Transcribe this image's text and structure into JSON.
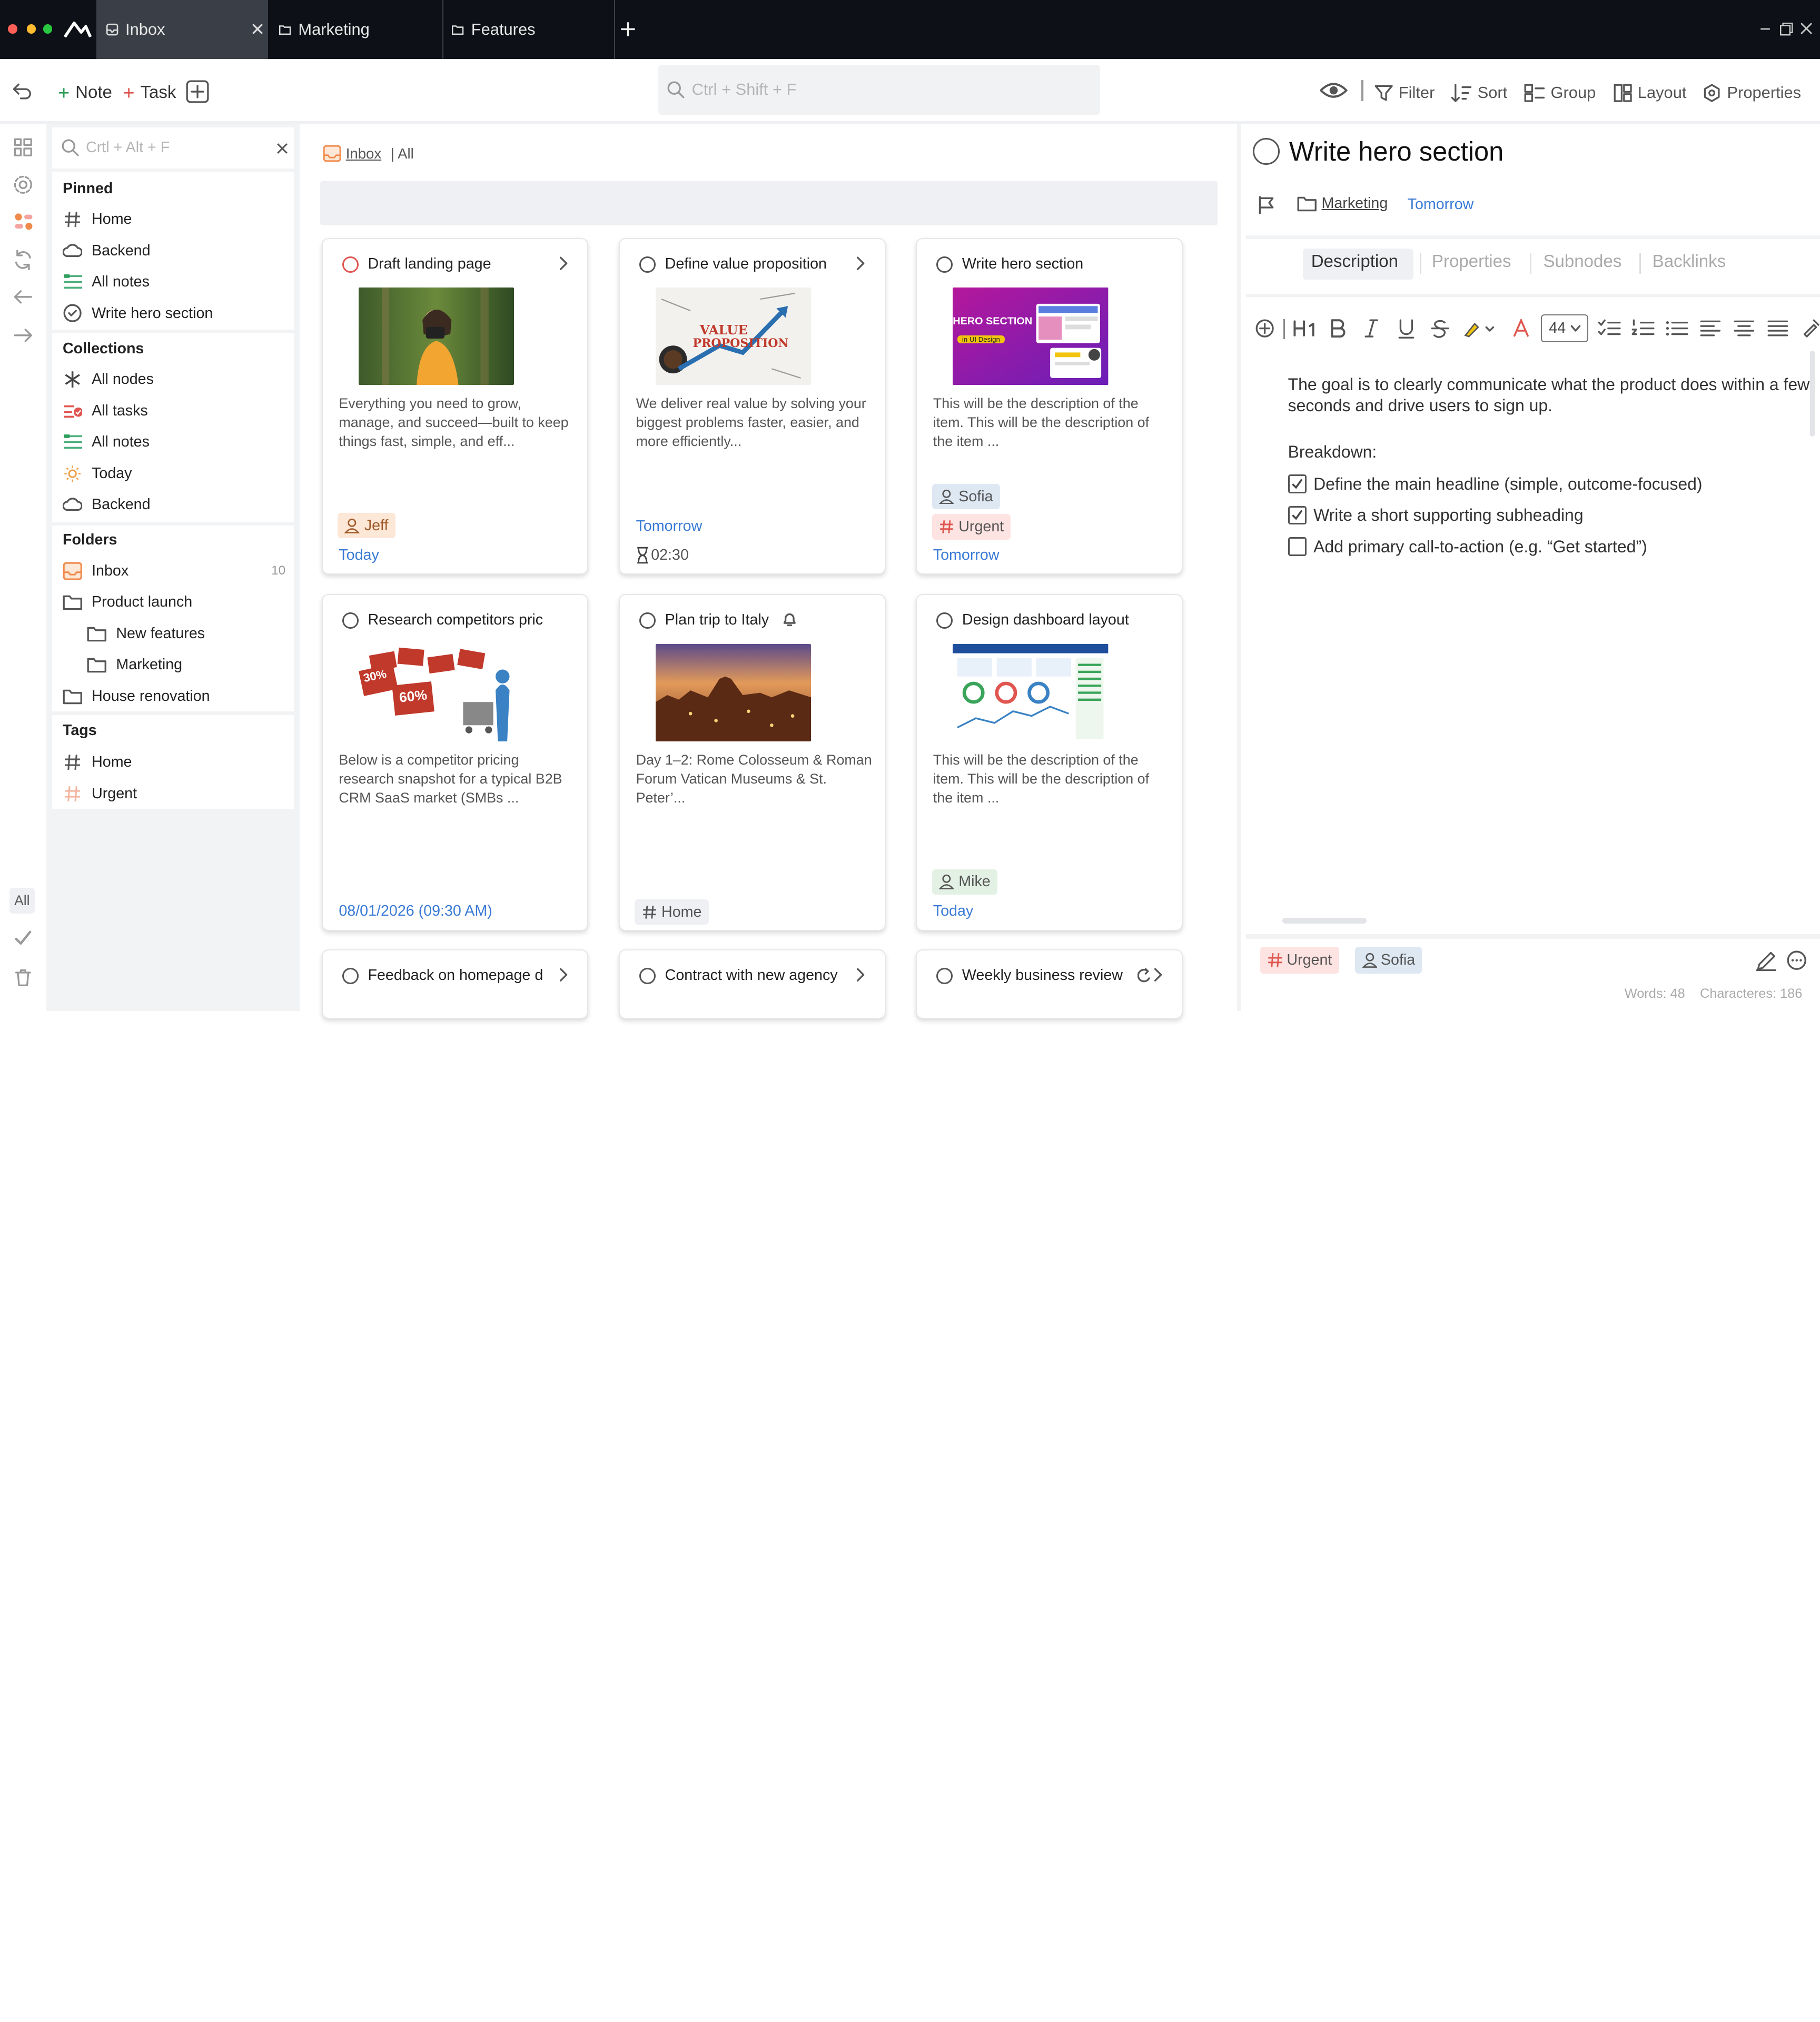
{
  "tabs": [
    {
      "label": "Inbox",
      "active": true
    },
    {
      "label": "Marketing",
      "active": false
    },
    {
      "label": "Features",
      "active": false
    }
  ],
  "toolbar": {
    "note_label": "Note",
    "task_label": "Task",
    "search_placeholder": "Ctrl + Shift + F",
    "filter_label": "Filter",
    "sort_label": "Sort",
    "group_label": "Group",
    "layout_label": "Layout",
    "properties_label": "Properties"
  },
  "rail": {
    "all_label": "All"
  },
  "sidebar": {
    "search_placeholder": "Crtl + Alt + F",
    "pinned": {
      "title": "Pinned",
      "items": [
        {
          "label": "Home",
          "icon": "hash-icon"
        },
        {
          "label": "Backend",
          "icon": "cloud-icon"
        },
        {
          "label": "All notes",
          "icon": "notes-icon"
        },
        {
          "label": "Write hero section",
          "icon": "check-circle-icon"
        }
      ]
    },
    "collections": {
      "title": "Collections",
      "items": [
        {
          "label": "All nodes",
          "icon": "asterisk-icon"
        },
        {
          "label": "All tasks",
          "icon": "tasks-icon"
        },
        {
          "label": "All notes",
          "icon": "notes-icon"
        },
        {
          "label": "Today",
          "icon": "sun-icon"
        },
        {
          "label": "Backend",
          "icon": "cloud-icon"
        }
      ]
    },
    "folders": {
      "title": "Folders",
      "items": [
        {
          "label": "Inbox",
          "icon": "inbox-icon",
          "count": "10"
        },
        {
          "label": "Product launch",
          "icon": "folder-icon"
        },
        {
          "label": "New features",
          "icon": "folder-icon"
        },
        {
          "label": "Marketing",
          "icon": "folder-icon"
        },
        {
          "label": "House renovation",
          "icon": "folder-icon"
        }
      ]
    },
    "tags": {
      "title": "Tags",
      "items": [
        {
          "label": "Home",
          "icon": "hash-icon"
        },
        {
          "label": "Urgent",
          "icon": "hash-icon"
        }
      ]
    }
  },
  "middle": {
    "breadcrumb_inbox": "Inbox",
    "breadcrumb_view": "| All",
    "cards": [
      {
        "title": "Draft landing page",
        "desc": "Everything you need to grow, manage, and succeed—built to keep things fast, simple, and eff...",
        "person": "Jeff",
        "date": "Today"
      },
      {
        "title": "Define value proposition",
        "desc": "We deliver real value by solving your biggest problems faster, easier, and more efficiently...",
        "date": "Tomorrow",
        "timer": "02:30",
        "thumb_text_1": "VALUE",
        "thumb_text_2": "PROPOSITION"
      },
      {
        "title": "Write hero section",
        "desc": "This will be the description of the item.  This will be the description of the item ...",
        "person": "Sofia",
        "tag": "Urgent",
        "date": "Tomorrow",
        "thumb_text_1": "HERO SECTION",
        "thumb_text_2": "in UI Design"
      },
      {
        "title": "Research competitors pric",
        "desc": "Below is a competitor pricing research snapshot for a typical B2B CRM SaaS market (SMBs ...",
        "date": "08/01/2026 (09:30 AM)",
        "thumb_text_1": "30%",
        "thumb_text_2": "60%"
      },
      {
        "title": "Plan trip to Italy",
        "desc": "Day 1–2: Rome Colosseum & Roman Forum Vatican Museums & St. Peter’...",
        "tag": "Home"
      },
      {
        "title": "Design dashboard layout",
        "desc": "This will be the description of the item.  This will be the description of the item ...",
        "person": "Mike",
        "date": "Today"
      },
      {
        "title": "Feedback on homepage d"
      },
      {
        "title": "Contract with new agency"
      },
      {
        "title": "Weekly business review"
      }
    ]
  },
  "detail": {
    "title": "Write hero section",
    "folder": "Marketing",
    "due": "Tomorrow",
    "tabs": [
      "Description",
      "Properties",
      "Subnodes",
      "Backlinks"
    ],
    "font_size": "44",
    "body": "The goal is to clearly communicate what the product does within a few seconds and drive users to sign up.",
    "breakdown_label": "Breakdown:",
    "checklist": [
      {
        "label": "Define the main headline (simple, outcome-focused)",
        "checked": true
      },
      {
        "label": "Write a short supporting subheading",
        "checked": true
      },
      {
        "label": "Add primary call-to-action (e.g. “Get started”)",
        "checked": false
      }
    ],
    "footer_tag": "Urgent",
    "footer_person": "Sofia",
    "words": "Words: 48",
    "characters": "Characteres: 186"
  },
  "colors": {
    "titlebar": "#0d1117",
    "accent_blue": "#3a7bd5",
    "tag_red": "#e0554f",
    "person_pill": "#dde8f3"
  }
}
